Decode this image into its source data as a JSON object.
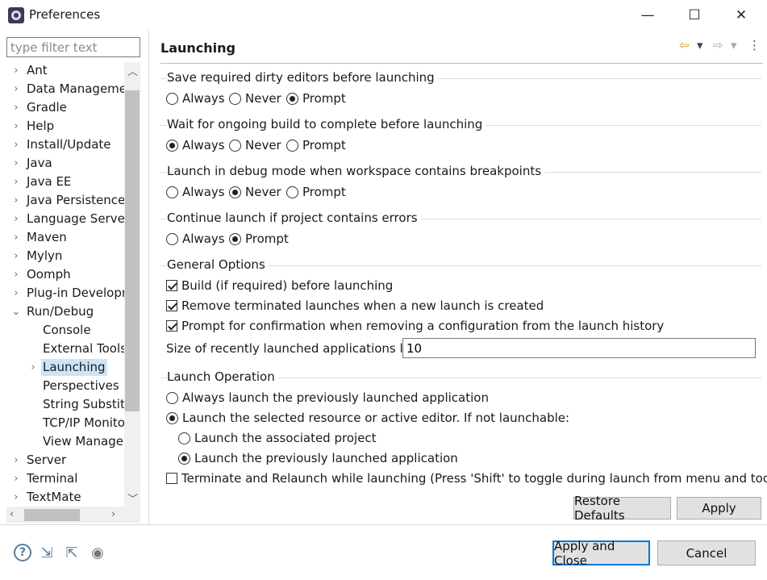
{
  "window": {
    "title": "Preferences",
    "minimize": "—",
    "maximize": "☐",
    "close": "✕"
  },
  "filter": {
    "placeholder": "type filter text"
  },
  "tree": {
    "items": [
      {
        "label": "Ant",
        "expander": "›"
      },
      {
        "label": "Data Managemen",
        "expander": "›"
      },
      {
        "label": "Gradle",
        "expander": "›"
      },
      {
        "label": "Help",
        "expander": "›"
      },
      {
        "label": "Install/Update",
        "expander": "›"
      },
      {
        "label": "Java",
        "expander": "›"
      },
      {
        "label": "Java EE",
        "expander": "›"
      },
      {
        "label": "Java Persistence",
        "expander": "›"
      },
      {
        "label": "Language Servers",
        "expander": "›"
      },
      {
        "label": "Maven",
        "expander": "›"
      },
      {
        "label": "Mylyn",
        "expander": "›"
      },
      {
        "label": "Oomph",
        "expander": "›"
      },
      {
        "label": "Plug-in Developm",
        "expander": "›"
      },
      {
        "label": "Run/Debug",
        "expander": "⌄"
      },
      {
        "label": "Console",
        "expander": ""
      },
      {
        "label": "External Tools",
        "expander": ""
      },
      {
        "label": "Launching",
        "expander": "›"
      },
      {
        "label": "Perspectives",
        "expander": ""
      },
      {
        "label": "String Substitu",
        "expander": ""
      },
      {
        "label": "TCP/IP Monito",
        "expander": ""
      },
      {
        "label": "View Manager",
        "expander": ""
      },
      {
        "label": "Server",
        "expander": "›"
      },
      {
        "label": "Terminal",
        "expander": "›"
      },
      {
        "label": "TextMate",
        "expander": "›"
      }
    ],
    "selected": "Launching"
  },
  "page": {
    "title": "Launching",
    "save_dirty": {
      "title": "Save required dirty editors before launching",
      "options": [
        "Always",
        "Never",
        "Prompt"
      ],
      "selected": "Prompt"
    },
    "wait_build": {
      "title": "Wait for ongoing build to complete before launching",
      "options": [
        "Always",
        "Never",
        "Prompt"
      ],
      "selected": "Always"
    },
    "debug_mode": {
      "title": "Launch in debug mode when workspace contains breakpoints",
      "options": [
        "Always",
        "Never",
        "Prompt"
      ],
      "selected": "Never"
    },
    "continue_errors": {
      "title": "Continue launch if project contains errors",
      "options": [
        "Always",
        "Prompt"
      ],
      "selected": "Prompt"
    },
    "general": {
      "title": "General Options",
      "build": "Build (if required) before launching",
      "remove_terminated": "Remove terminated launches when a new launch is created",
      "prompt_remove": "Prompt for confirmation when removing a configuration from the launch history",
      "size_label": "Size of recently launched applications list:",
      "size_value": "10"
    },
    "launch_operation": {
      "title": "Launch Operation",
      "always_previous": "Always launch the previously launched application",
      "selected_resource": "Launch the selected resource or active editor. If not launchable:",
      "associated_project": "Launch the associated project",
      "previous_app": "Launch the previously launched application",
      "terminate_relaunch": "Terminate and Relaunch while launching (Press 'Shift' to toggle during launch from menu and toolbar)"
    },
    "restore_defaults": "Restore Defaults",
    "apply": "Apply"
  },
  "footer": {
    "apply_close": "Apply and Close",
    "cancel": "Cancel"
  },
  "icons": {
    "help": "?",
    "import": "⇲",
    "export": "⇱",
    "record": "◉",
    "back": "⇦",
    "forward": "⇨",
    "dropdown": "▾",
    "menu": "⋮"
  },
  "colors": {
    "selection": "#cce4f7",
    "accent": "#0078d7",
    "back_arrow": "#d4a017"
  }
}
